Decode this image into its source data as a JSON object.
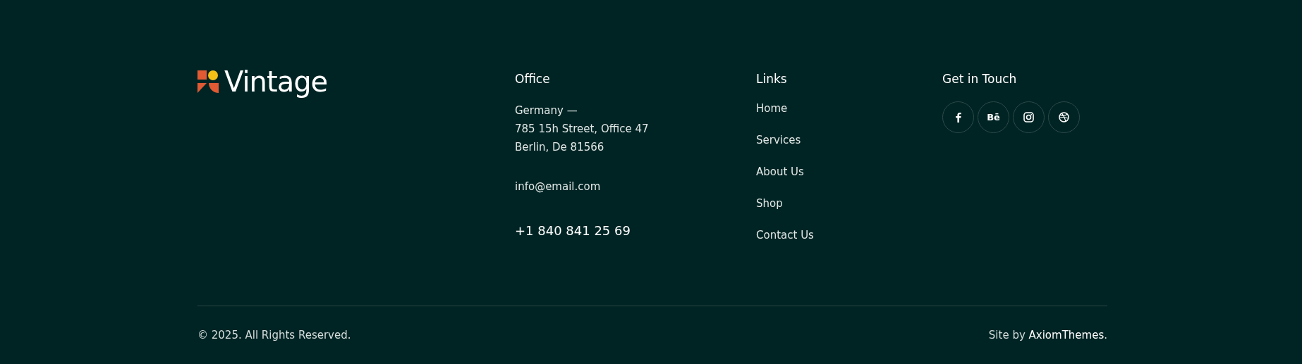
{
  "brand": {
    "name": "Vintage"
  },
  "office": {
    "title": "Office",
    "address": [
      "Germany —",
      "785 15h Street, Office 47",
      "Berlin, De 81566"
    ],
    "email": "info@email.com",
    "phone": "+1 840 841 25 69"
  },
  "links": {
    "title": "Links",
    "items": [
      "Home",
      "Services",
      "About Us",
      "Shop",
      "Contact Us"
    ]
  },
  "contact": {
    "title": "Get in Touch",
    "socials": [
      {
        "kind": "facebook"
      },
      {
        "kind": "behance",
        "label": "Bē"
      },
      {
        "kind": "instagram"
      },
      {
        "kind": "dribbble"
      }
    ]
  },
  "bottom": {
    "copyright": "© 2025. All Rights Reserved.",
    "credit_prefix": "Site by ",
    "credit_link": "AxiomThemes",
    "credit_suffix": "."
  }
}
